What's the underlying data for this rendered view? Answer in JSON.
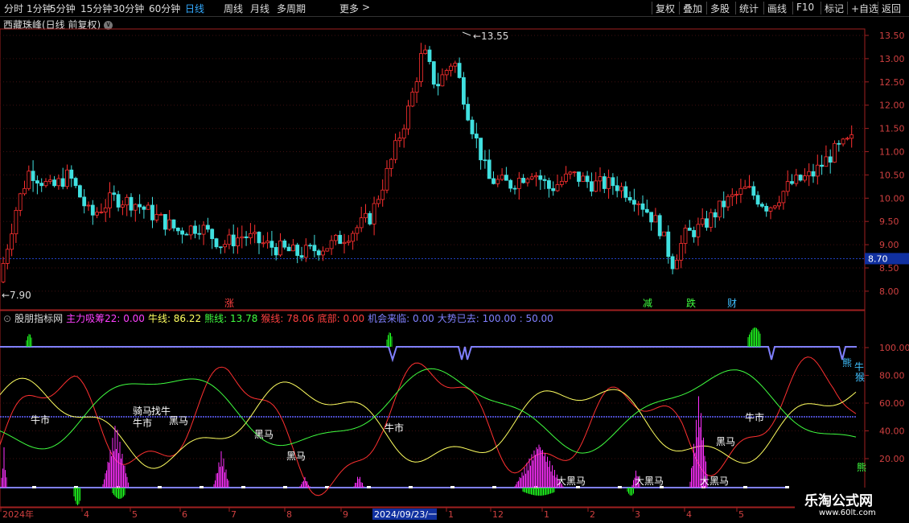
{
  "toolbar": {
    "periods": [
      "分时",
      "1分钟",
      "5分钟",
      "15分钟",
      "30分钟",
      "60分钟",
      "日线",
      "周线",
      "月线",
      "多周期",
      "更多"
    ],
    "active_period": "日线",
    "more_arrow": ">",
    "tools": [
      "复权",
      "叠加",
      "多股",
      "统计",
      "画线",
      "F10",
      "标记",
      "+自选",
      "返回"
    ]
  },
  "stock_title": "西藏珠峰(日线 前复权)",
  "title_dot": "∨",
  "price_axis": [
    "13.50",
    "13.00",
    "12.50",
    "12.00",
    "11.50",
    "11.00",
    "10.50",
    "10.00",
    "9.50",
    "9.00",
    "8.50",
    "8.00"
  ],
  "current_price": "8.70",
  "high_marker": "13.55",
  "low_marker": "7.90",
  "signals_top": [
    {
      "text": "涨",
      "color": "#ff4040"
    },
    {
      "text": "减",
      "color": "#40ff40"
    },
    {
      "text": "跌",
      "color": "#40ff40"
    },
    {
      "text": "财",
      "color": "#40c0ff"
    }
  ],
  "indicator": {
    "name": "股朋指标网",
    "items": [
      {
        "label": "主力吸筹22:",
        "value": "0.00",
        "color": "#ff40ff"
      },
      {
        "label": "牛线:",
        "value": "86.22",
        "color": "#ffff60"
      },
      {
        "label": "熊线:",
        "value": "13.78",
        "color": "#40ff40"
      },
      {
        "label": "猴线:",
        "value": "78.06",
        "color": "#ff4040"
      },
      {
        "label": "底部:",
        "value": "0.00",
        "color": "#ff4040"
      },
      {
        "label": "机会来临:",
        "value": "0.00",
        "color": "#8080ff"
      },
      {
        "label": "大势已去:",
        "value": "100.00",
        "color": "#8080ff"
      },
      {
        "label": ":",
        "value": "50.00",
        "color": "#8080ff"
      }
    ],
    "axis": [
      "100.00",
      "80.00",
      "60.00",
      "40.00",
      "20.00"
    ],
    "labels": [
      {
        "text": "牛市",
        "color": "#ffffff"
      },
      {
        "text": "骑马",
        "color": "#ffffff"
      },
      {
        "text": "找牛",
        "color": "#ffffff"
      },
      {
        "text": "牛市",
        "color": "#ffffff"
      },
      {
        "text": "黑马",
        "color": "#ffffff"
      },
      {
        "text": "黑马",
        "color": "#ffffff"
      },
      {
        "text": "黑马",
        "color": "#ffffff"
      },
      {
        "text": "牛市",
        "color": "#ffffff"
      },
      {
        "text": "大黑马",
        "color": "#ffffff"
      },
      {
        "text": "大黑马",
        "color": "#ffffff"
      },
      {
        "text": "大黑马",
        "color": "#ffffff"
      },
      {
        "text": "黑马",
        "color": "#ffffff"
      },
      {
        "text": "牛市",
        "color": "#ffffff"
      },
      {
        "text": "熊",
        "color": "#40ff40"
      },
      {
        "text": "牛",
        "color": "#40c0ff"
      },
      {
        "text": "猴",
        "color": "#40c0ff"
      },
      {
        "text": "熊",
        "color": "#40c0ff"
      }
    ]
  },
  "xaxis": [
    "2024年",
    "4",
    "5",
    "6",
    "7",
    "8",
    "9",
    "2024/09/23/一",
    "1",
    "12",
    "1",
    "2",
    "3",
    "4",
    "5"
  ],
  "watermark": {
    "title": "乐淘公式网",
    "url": "www.60lt.com"
  }
}
